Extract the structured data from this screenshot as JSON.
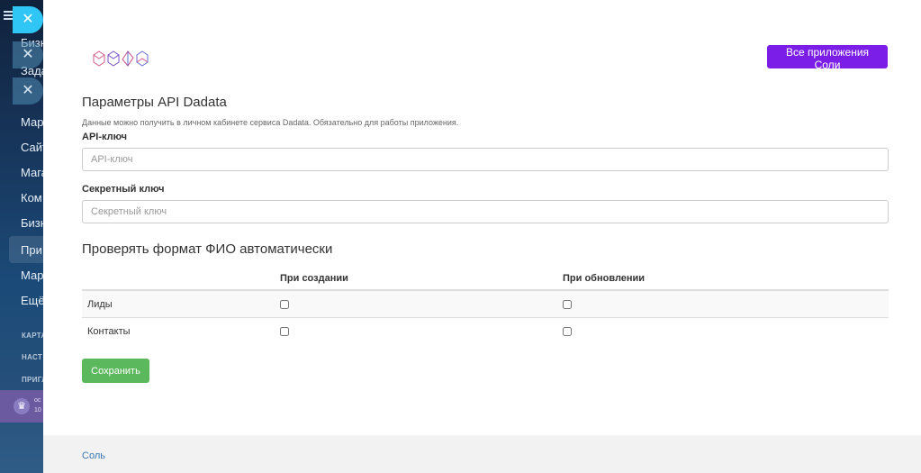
{
  "sidebar": {
    "items": [
      {
        "label": "Бизн"
      },
      {
        "label": "Зада"
      },
      {
        "label": "Мар"
      },
      {
        "label": "Сайт"
      },
      {
        "label": "Мага"
      },
      {
        "label": "Ком"
      },
      {
        "label": "Бизн"
      },
      {
        "label": "При"
      },
      {
        "label": "Мар"
      },
      {
        "label": "Ещё"
      }
    ],
    "small_items": [
      {
        "label": "КАРТА"
      },
      {
        "label": "НАСТ"
      },
      {
        "label": "ПРИГЛ"
      }
    ],
    "promo": {
      "line1": "ос",
      "line2": "10"
    }
  },
  "close_buttons": [
    "✕",
    "✕",
    "✕"
  ],
  "header": {
    "all_apps_button": "Все приложения Соли"
  },
  "api_section": {
    "title": "Параметры API Dadata",
    "hint": "Данные можно получить в личном кабинете сервиса Dadata. Обязательно для работы приложения.",
    "api_key": {
      "label": "API-ключ",
      "placeholder": "API-ключ",
      "value": ""
    },
    "secret_key": {
      "label": "Секретный ключ",
      "placeholder": "Секретный ключ",
      "value": ""
    }
  },
  "fio_section": {
    "title": "Проверять формат ФИО автоматически",
    "columns": [
      "",
      "При создании",
      "При обновлении"
    ],
    "rows": [
      {
        "label": "Лиды",
        "on_create": false,
        "on_update": false
      },
      {
        "label": "Контакты",
        "on_create": false,
        "on_update": false
      }
    ]
  },
  "save_button": "Сохранить",
  "footer": {
    "link": "Соль"
  },
  "colors": {
    "accent_purple": "#7b1fe8",
    "save_green": "#5cb85c",
    "close_blue": "#2fc6f6",
    "link_blue": "#3a78b5"
  }
}
